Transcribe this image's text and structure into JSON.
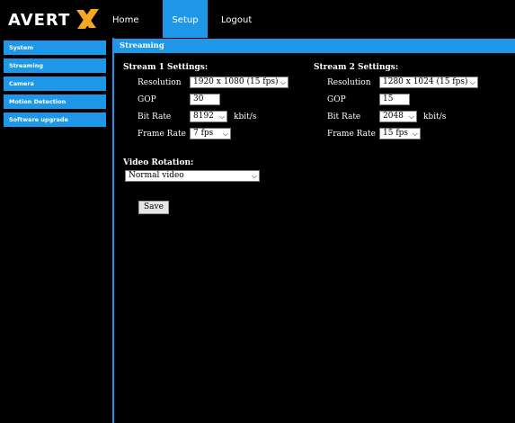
{
  "nav": {
    "home": "Home",
    "setup": "Setup",
    "logout": "Logout"
  },
  "sidebar": {
    "items": [
      {
        "label": "System"
      },
      {
        "label": "Streaming"
      },
      {
        "label": "Camera"
      },
      {
        "label": "Motion Detection"
      },
      {
        "label": "Software upgrade"
      }
    ]
  },
  "page": {
    "title": "Streaming"
  },
  "stream1": {
    "title": "Stream 1 Settings:",
    "resolution_label": "Resolution",
    "resolution": "1920 x 1080 (15 fps)",
    "gop_label": "GOP",
    "gop": "30",
    "bitrate_label": "Bit Rate",
    "bitrate": "8192",
    "bitrate_unit": "kbit/s",
    "framerate_label": "Frame Rate",
    "framerate": "7 fps"
  },
  "stream2": {
    "title": "Stream 2 Settings:",
    "resolution_label": "Resolution",
    "resolution": "1280 x 1024 (15 fps)",
    "gop_label": "GOP",
    "gop": "15",
    "bitrate_label": "Bit Rate",
    "bitrate": "2048",
    "bitrate_unit": "kbit/s",
    "framerate_label": "Frame Rate",
    "framerate": "15 fps"
  },
  "rotation": {
    "title": "Video Rotation:",
    "value": "Normal video"
  },
  "save_label": "Save",
  "brand": {
    "logo_text": "AVERTX",
    "accent": "#1e97e8",
    "x_color": "#f5a623"
  }
}
